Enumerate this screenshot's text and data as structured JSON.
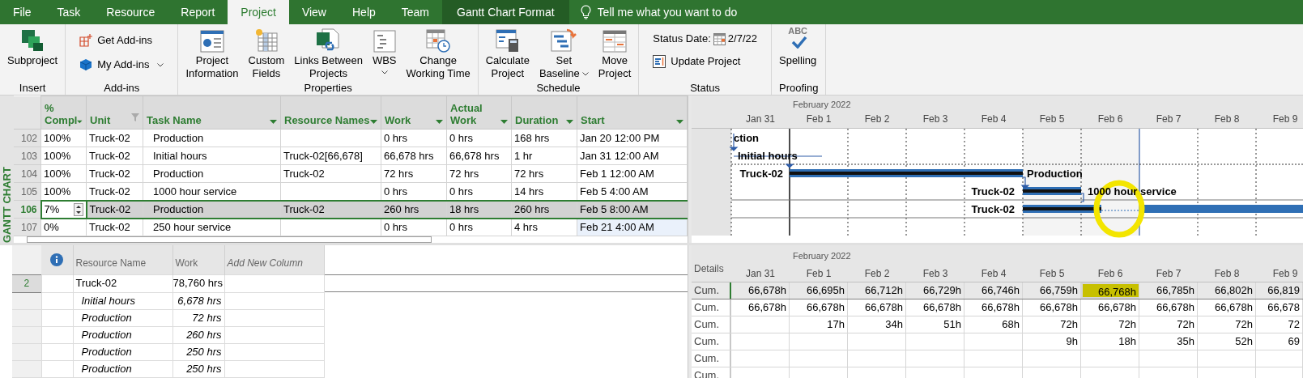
{
  "tabs": [
    {
      "label": "File",
      "selected": false,
      "kind": "normal"
    },
    {
      "label": "Task",
      "selected": false,
      "kind": "normal"
    },
    {
      "label": "Resource",
      "selected": false,
      "kind": "normal"
    },
    {
      "label": "Report",
      "selected": false,
      "kind": "normal"
    },
    {
      "label": "Project",
      "selected": true,
      "kind": "normal"
    },
    {
      "label": "View",
      "selected": false,
      "kind": "normal"
    },
    {
      "label": "Help",
      "selected": false,
      "kind": "normal"
    },
    {
      "label": "Team",
      "selected": false,
      "kind": "normal"
    },
    {
      "label": "Gantt Chart Format",
      "selected": false,
      "kind": "contextual"
    }
  ],
  "tell_me": {
    "placeholder": "Tell me what you want to do"
  },
  "ribbon_groups": [
    {
      "label": "Insert",
      "items": [
        {
          "kind": "large",
          "lines": [
            "Subproject"
          ],
          "dropdown": false
        }
      ]
    },
    {
      "label": "Add-ins",
      "items": [
        {
          "kind": "small",
          "lines": [
            "Get Add-ins"
          ],
          "dropdown": false
        },
        {
          "kind": "small",
          "lines": [
            "My Add-ins"
          ],
          "dropdown": true
        }
      ]
    },
    {
      "label": "Properties",
      "items": [
        {
          "kind": "large",
          "lines": [
            "Project",
            "Information"
          ],
          "dropdown": false
        },
        {
          "kind": "large",
          "lines": [
            "Custom",
            "Fields"
          ],
          "dropdown": false
        },
        {
          "kind": "large",
          "lines": [
            "Links Between",
            "Projects"
          ],
          "dropdown": false
        },
        {
          "kind": "large",
          "lines": [
            "WBS"
          ],
          "dropdown": true
        },
        {
          "kind": "large",
          "lines": [
            "Change",
            "Working Time"
          ],
          "dropdown": false
        }
      ]
    },
    {
      "label": "Schedule",
      "items": [
        {
          "kind": "large",
          "lines": [
            "Calculate",
            "Project"
          ],
          "dropdown": false
        },
        {
          "kind": "large",
          "lines": [
            "Set",
            "Baseline"
          ],
          "dropdown": true
        },
        {
          "kind": "large",
          "lines": [
            "Move",
            "Project"
          ],
          "dropdown": false
        }
      ]
    },
    {
      "label": "Status",
      "items": [
        {
          "kind": "date",
          "lines": [
            "Status Date:"
          ],
          "value": "2/7/22"
        },
        {
          "kind": "small",
          "lines": [
            "Update Project"
          ],
          "dropdown": false
        }
      ]
    },
    {
      "label": "Proofing",
      "items": [
        {
          "kind": "large",
          "icon_text": "ABC",
          "lines": [
            "Spelling"
          ],
          "dropdown": false
        }
      ]
    }
  ],
  "view_label": "GANTT CHART",
  "task_table": {
    "columns": [
      {
        "lines": [
          "%",
          "Compl"
        ],
        "filtered": false
      },
      {
        "lines": [
          "Unit"
        ],
        "filtered": true
      },
      {
        "lines": [
          "Task Name"
        ],
        "filtered": false
      },
      {
        "lines": [
          "Resource Names"
        ],
        "filtered": false
      },
      {
        "lines": [
          "Work"
        ],
        "filtered": false
      },
      {
        "lines": [
          "Actual",
          "Work"
        ],
        "filtered": false
      },
      {
        "lines": [
          "Duration"
        ],
        "filtered": false
      },
      {
        "lines": [
          "Start"
        ],
        "filtered": false
      }
    ],
    "rows": [
      {
        "id": "102",
        "selected": false,
        "cells": [
          "100%",
          "Truck-02",
          "Production",
          null,
          "0 hrs",
          "0 hrs",
          "168 hrs",
          "Jan 20 12:00 PM"
        ]
      },
      {
        "id": "103",
        "selected": false,
        "cells": [
          "100%",
          "Truck-02",
          "Initial hours",
          "Truck-02[66,678]",
          "66,678 hrs",
          "66,678 hrs",
          "1 hr",
          "Jan 31 12:00 AM"
        ]
      },
      {
        "id": "104",
        "selected": false,
        "cells": [
          "100%",
          "Truck-02",
          "Production",
          "Truck-02",
          "72 hrs",
          "72 hrs",
          "72 hrs",
          "Feb 1 12:00 AM"
        ]
      },
      {
        "id": "105",
        "selected": false,
        "cells": [
          "100%",
          "Truck-02",
          "1000 hour service",
          null,
          "0 hrs",
          "0 hrs",
          "14 hrs",
          "Feb 5 4:00 AM"
        ]
      },
      {
        "id": "106",
        "selected": true,
        "cells": [
          "7%",
          "Truck-02",
          "Production",
          "Truck-02",
          "260 hrs",
          "18 hrs",
          "260 hrs",
          "Feb 5 8:00 AM"
        ]
      },
      {
        "id": "107",
        "selected": false,
        "cells": [
          "0%",
          "Truck-02",
          "250 hour service",
          null,
          "0 hrs",
          "0 hrs",
          "4 hrs",
          "Feb 21 4:00 AM"
        ]
      }
    ]
  },
  "gantt": {
    "month": "February 2022",
    "days": [
      "Jan 31",
      "Feb 1",
      "Feb 2",
      "Feb 3",
      "Feb 4",
      "Feb 5",
      "Feb 6",
      "Feb 7",
      "Feb 8",
      "Feb 9"
    ],
    "rows": [
      {
        "right_label": "ction"
      },
      {
        "right_label": "Initial hours"
      },
      {
        "left_label": "Truck-02",
        "right_label": "Production"
      },
      {
        "left_label": "Truck-02",
        "right_label": "1000 hour service"
      },
      {
        "left_label": "Truck-02"
      }
    ]
  },
  "usage_table": {
    "columns": [
      "Resource Name",
      "Work",
      "Add New Column"
    ],
    "rows": [
      {
        "kind": "resource",
        "id": "2",
        "name": "Truck-02",
        "work": "78,760 hrs"
      },
      {
        "kind": "assignment",
        "name": "Initial hours",
        "work": "6,678 hrs"
      },
      {
        "kind": "assignment",
        "name": "Production",
        "work": "72 hrs"
      },
      {
        "kind": "assignment",
        "name": "Production",
        "work": "260 hrs"
      },
      {
        "kind": "assignment",
        "name": "Production",
        "work": "250 hrs"
      },
      {
        "kind": "assignment",
        "name": "Production",
        "work": "250 hrs"
      }
    ]
  },
  "usage_grid": {
    "details_label": "Details",
    "month": "February 2022",
    "days": [
      "Jan 31",
      "Feb 1",
      "Feb 2",
      "Feb 3",
      "Feb 4",
      "Feb 5",
      "Feb 6",
      "Feb 7",
      "Feb 8",
      "Feb 9"
    ],
    "rows": [
      {
        "label": "Cum.",
        "selected": true,
        "cells": [
          {
            "text": "66,678h",
            "highlighted": false
          },
          {
            "text": "66,695h",
            "highlighted": false
          },
          {
            "text": "66,712h",
            "highlighted": false
          },
          {
            "text": "66,729h",
            "highlighted": false
          },
          {
            "text": "66,746h",
            "highlighted": false
          },
          {
            "text": "66,759h",
            "highlighted": false
          },
          {
            "text": "66,768h",
            "highlighted": true
          },
          {
            "text": "66,785h",
            "highlighted": false
          },
          {
            "text": "66,802h",
            "highlighted": false
          },
          {
            "text": "66,819",
            "highlighted": false
          }
        ]
      },
      {
        "label": "Cum.",
        "selected": false,
        "cells": [
          {
            "text": "66,678h",
            "highlighted": false
          },
          {
            "text": "66,678h",
            "highlighted": false
          },
          {
            "text": "66,678h",
            "highlighted": false
          },
          {
            "text": "66,678h",
            "highlighted": false
          },
          {
            "text": "66,678h",
            "highlighted": false
          },
          {
            "text": "66,678h",
            "highlighted": false
          },
          {
            "text": "66,678h",
            "highlighted": false
          },
          {
            "text": "66,678h",
            "highlighted": false
          },
          {
            "text": "66,678h",
            "highlighted": false
          },
          {
            "text": "66,678",
            "highlighted": false
          }
        ]
      },
      {
        "label": "Cum.",
        "selected": false,
        "cells": [
          {
            "highlighted": false
          },
          {
            "text": "17h",
            "highlighted": false
          },
          {
            "text": "34h",
            "highlighted": false
          },
          {
            "text": "51h",
            "highlighted": false
          },
          {
            "text": "68h",
            "highlighted": false
          },
          {
            "text": "72h",
            "highlighted": false
          },
          {
            "text": "72h",
            "highlighted": false
          },
          {
            "text": "72h",
            "highlighted": false
          },
          {
            "text": "72h",
            "highlighted": false
          },
          {
            "text": "72",
            "highlighted": false
          }
        ]
      },
      {
        "label": "Cum.",
        "selected": false,
        "cells": [
          {
            "highlighted": false
          },
          {
            "highlighted": false
          },
          {
            "highlighted": false
          },
          {
            "highlighted": false
          },
          {
            "highlighted": false
          },
          {
            "text": "9h",
            "highlighted": false
          },
          {
            "text": "18h",
            "highlighted": false
          },
          {
            "text": "35h",
            "highlighted": false
          },
          {
            "text": "52h",
            "highlighted": false
          },
          {
            "text": "69",
            "highlighted": false
          }
        ]
      },
      {
        "label": "Cum.",
        "selected": false,
        "cells": [
          {
            "highlighted": false
          },
          {
            "highlighted": false
          },
          {
            "highlighted": false
          },
          {
            "highlighted": false
          },
          {
            "highlighted": false
          },
          {
            "highlighted": false
          },
          {
            "highlighted": false
          },
          {
            "highlighted": false
          },
          {
            "highlighted": false
          },
          {
            "highlighted": false
          }
        ]
      },
      {
        "label": "Cum.",
        "selected": false,
        "cells": [
          {
            "highlighted": false
          },
          {
            "highlighted": false
          },
          {
            "highlighted": false
          },
          {
            "highlighted": false
          },
          {
            "highlighted": false
          },
          {
            "highlighted": false
          },
          {
            "highlighted": false
          },
          {
            "highlighted": false
          },
          {
            "highlighted": false
          },
          {
            "highlighted": false
          }
        ]
      }
    ]
  }
}
